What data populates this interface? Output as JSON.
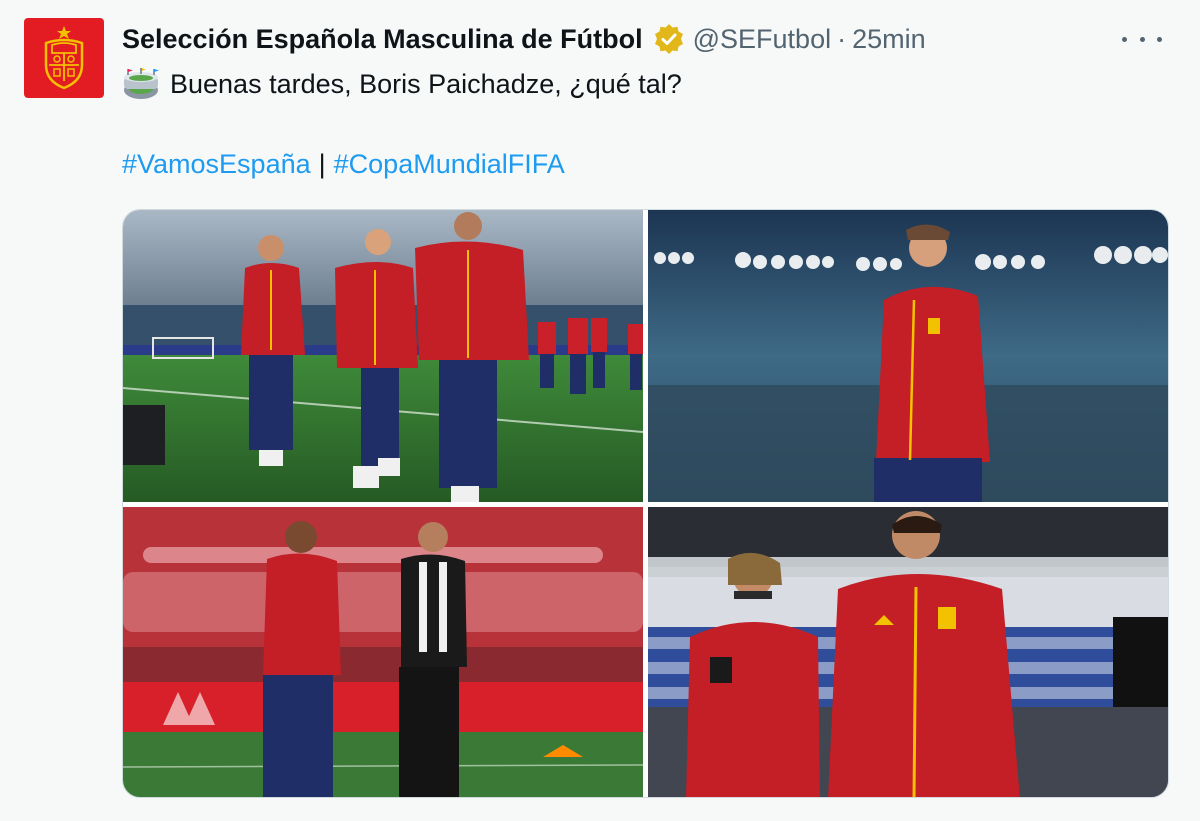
{
  "account": {
    "display_name": "Selección Española Masculina de Fútbol",
    "handle": "@SEFutbol",
    "separator": "·",
    "timestamp": "25min",
    "verified_icon": "verified-gold-badge"
  },
  "tweet": {
    "emoji_icon": "stadium-emoji",
    "text": "Buenas tardes, Boris Paichadze, ¿qué tal?",
    "hashtags": [
      "#VamosEspaña",
      "#CopaMundialFIFA"
    ],
    "hashtag_separator": "|"
  },
  "media": {
    "photos": [
      {
        "name": "players-walking-pitch"
      },
      {
        "name": "player-stadium-lights"
      },
      {
        "name": "player-and-staff-talking"
      },
      {
        "name": "players-with-phone"
      }
    ]
  },
  "colors": {
    "brand_red": "#e31c23",
    "link_blue": "#1d9bf0",
    "verified_gold": "#e2b719",
    "muted_text": "#536471"
  }
}
